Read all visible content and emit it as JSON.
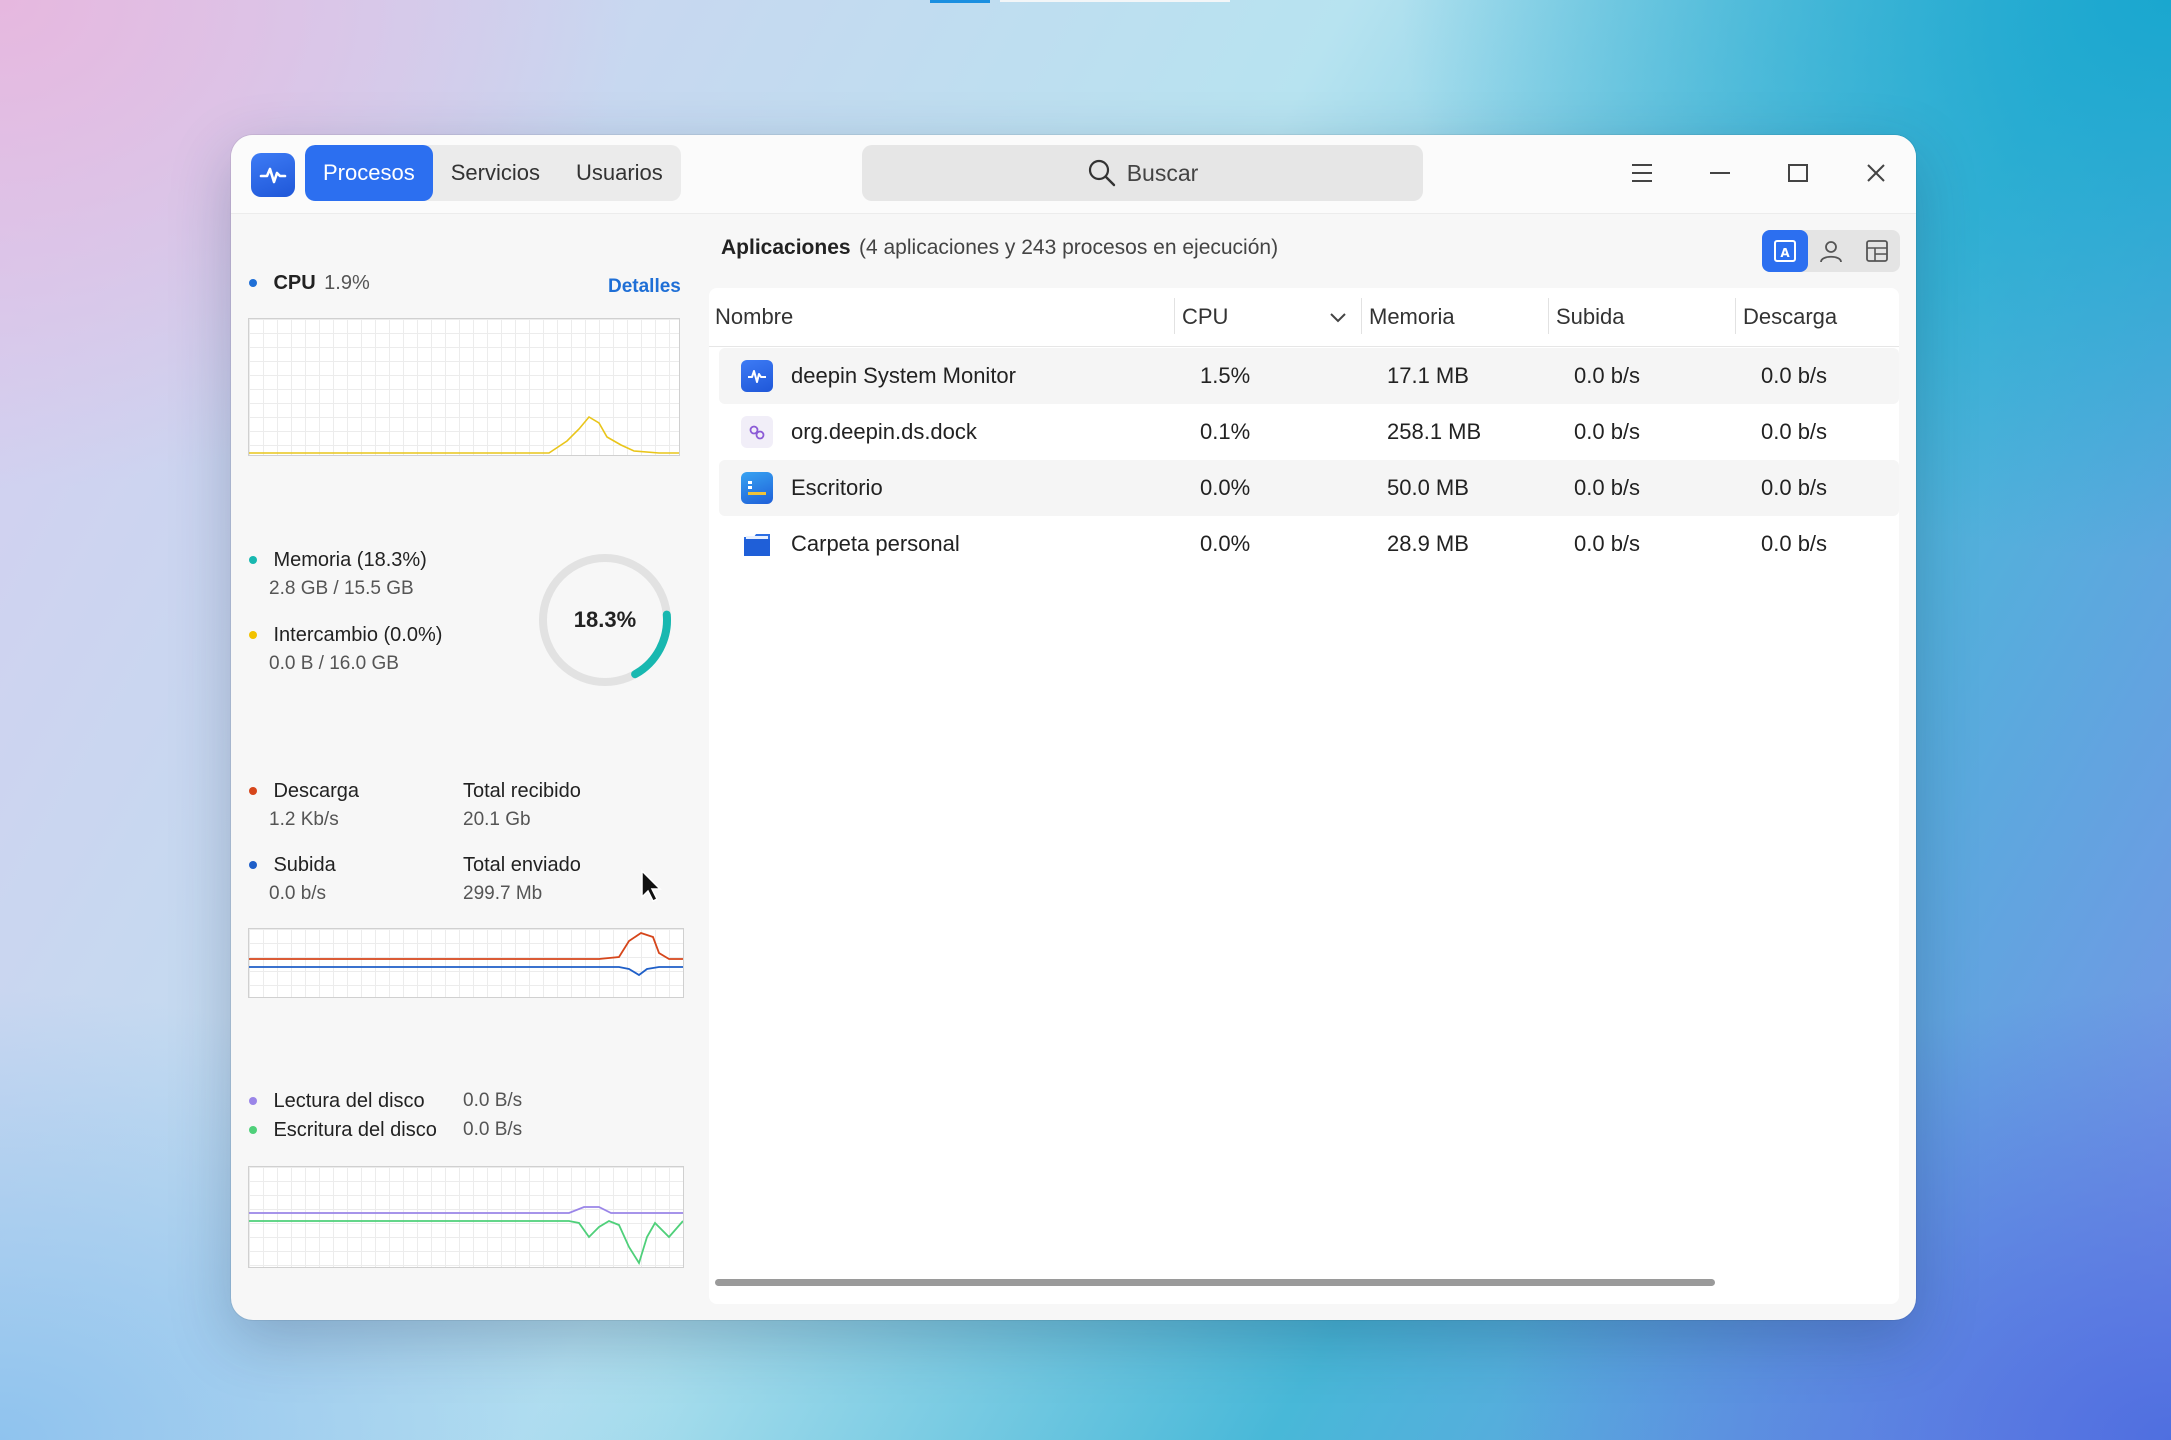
{
  "window": {
    "tabs": [
      {
        "label": "Procesos",
        "active": true
      },
      {
        "label": "Servicios",
        "active": false
      },
      {
        "label": "Usuarios",
        "active": false
      }
    ],
    "search": {
      "placeholder": "Buscar"
    }
  },
  "sidebar": {
    "cpu": {
      "label": "CPU",
      "value": "1.9%",
      "details_link": "Detalles"
    },
    "memory": {
      "label": "Memoria (18.3%)",
      "usage": "2.8 GB / 15.5 GB",
      "swap_label": "Intercambio (0.0%)",
      "swap_usage": "0.0 B / 16.0 GB",
      "ring_value": "18.3%",
      "ring_fraction": 0.183
    },
    "network": {
      "download_label": "Descarga",
      "download_value": "1.2 Kb/s",
      "total_received_label": "Total recibido",
      "total_received_value": "20.1 Gb",
      "upload_label": "Subida",
      "upload_value": "0.0 b/s",
      "total_sent_label": "Total enviado",
      "total_sent_value": "299.7 Mb"
    },
    "disk": {
      "read_label": "Lectura del disco",
      "read_value": "0.0 B/s",
      "write_label": "Escritura del disco",
      "write_value": "0.0 B/s"
    }
  },
  "main": {
    "title": "Aplicaciones",
    "summary": "(4 aplicaciones y 243 procesos en ejecución)",
    "columns": [
      "Nombre",
      "CPU",
      "Memoria",
      "Subida",
      "Descarga"
    ],
    "rows": [
      {
        "name": "deepin System Monitor",
        "icon": "system-monitor-icon",
        "cpu": "1.5%",
        "memory": "17.1 MB",
        "upload": "0.0 b/s",
        "download": "0.0 b/s"
      },
      {
        "name": "org.deepin.ds.dock",
        "icon": "dock-icon",
        "cpu": "0.1%",
        "memory": "258.1 MB",
        "upload": "0.0 b/s",
        "download": "0.0 b/s"
      },
      {
        "name": "Escritorio",
        "icon": "desktop-icon",
        "cpu": "0.0%",
        "memory": "50.0 MB",
        "upload": "0.0 b/s",
        "download": "0.0 b/s"
      },
      {
        "name": "Carpeta personal",
        "icon": "home-folder-icon",
        "cpu": "0.0%",
        "memory": "28.9 MB",
        "upload": "0.0 b/s",
        "download": "0.0 b/s"
      }
    ]
  },
  "colors": {
    "accent": "#2c6ff0",
    "cpu": "#1f6fd6",
    "memory": "#18b8b0",
    "swap": "#f2c200",
    "download": "#d6461b",
    "upload": "#1f5fc8",
    "disk_read": "#9a85e8",
    "disk_write": "#4fd07a"
  }
}
